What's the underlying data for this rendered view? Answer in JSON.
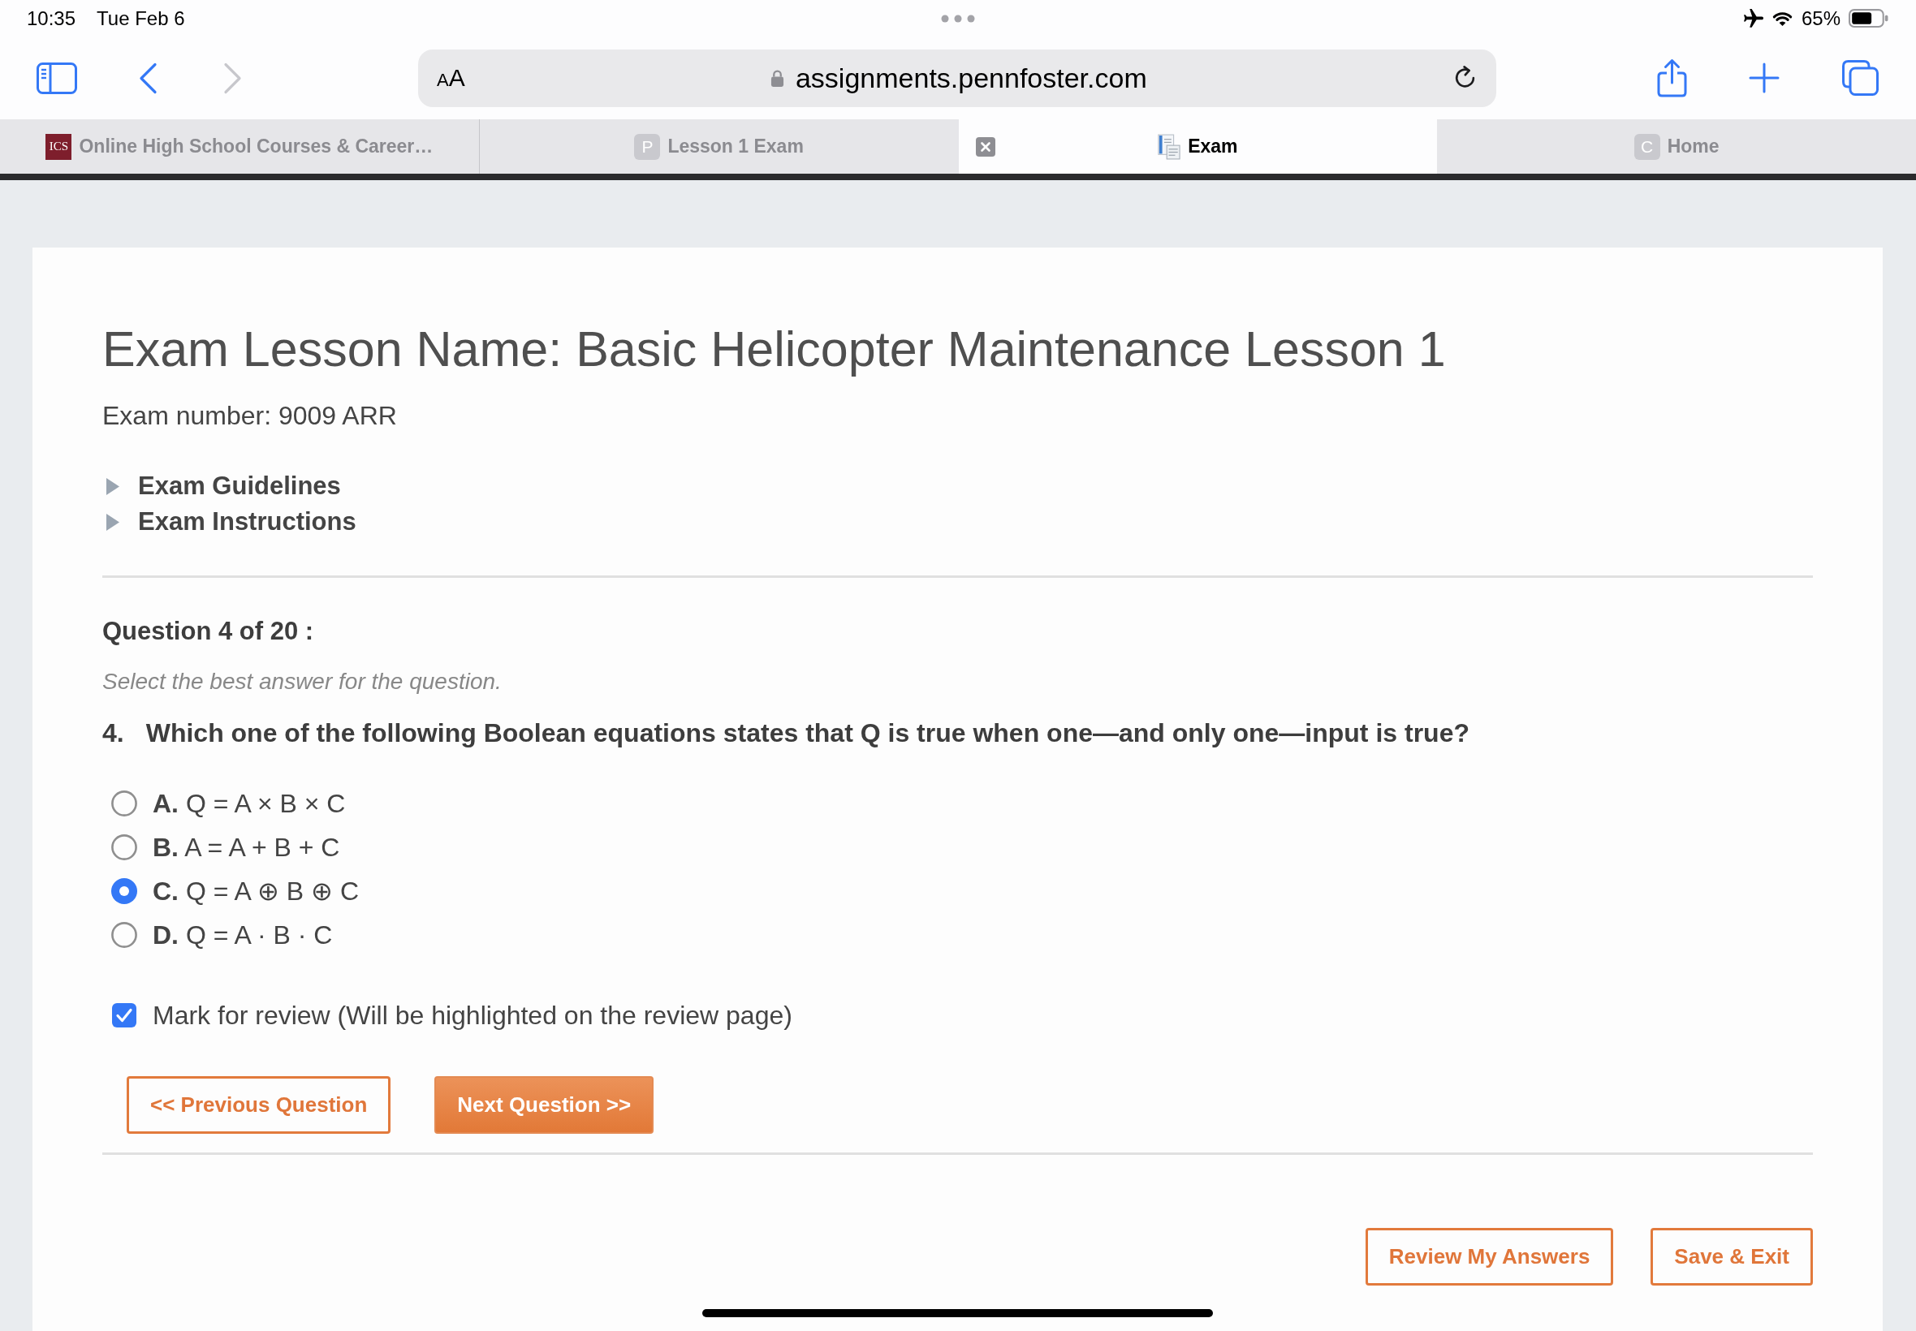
{
  "status_bar": {
    "time": "10:35",
    "date": "Tue Feb 6",
    "battery": "65%"
  },
  "toolbar": {
    "nav_buttons": [
      {
        "kind": "back",
        "disabled": false
      },
      {
        "kind": "forward",
        "disabled": true
      }
    ],
    "text_size_button": {
      "small": "A",
      "large": "A"
    },
    "url": "assignments.pennfoster.com"
  },
  "tabs": [
    {
      "label": "Online High School Courses & Career…",
      "favicon": {
        "kind": "logo",
        "text": "ICS"
      },
      "selected": false
    },
    {
      "label": "Lesson 1 Exam",
      "favicon": {
        "kind": "letter",
        "text": "P"
      },
      "selected": false
    },
    {
      "label": "Exam",
      "favicon": {
        "kind": "document"
      },
      "selected": true
    },
    {
      "label": "Home",
      "favicon": {
        "kind": "letter",
        "text": "C"
      },
      "selected": false
    }
  ],
  "exam": {
    "title": "Exam Lesson Name: Basic Helicopter Maintenance Lesson 1",
    "exam_number": "Exam number: 9009 ARR",
    "sections": [
      {
        "label": "Exam Guidelines",
        "expanded": false
      },
      {
        "label": "Exam Instructions",
        "expanded": false
      }
    ]
  },
  "question": {
    "heading": "Question 4 of 20 :",
    "instruction": "Select the best answer for the question.",
    "number": "4.",
    "text": "Which one of the following Boolean equations states that Q is true when one—and only one—input is true?",
    "options": [
      {
        "letter": "A.",
        "text": "Q = A × B × C",
        "selected": false
      },
      {
        "letter": "B.",
        "text": "A = A + B + C",
        "selected": false
      },
      {
        "letter": "C.",
        "text": "Q = A ⊕ B ⊕ C",
        "selected": true
      },
      {
        "letter": "D.",
        "text": "Q = A · B · C",
        "selected": false
      }
    ],
    "mark_for_review": {
      "label": "Mark for review (Will be highlighted on the review page)",
      "checked": true
    }
  },
  "navigation_buttons": [
    {
      "label": "<< Previous Question",
      "kind": "outline"
    },
    {
      "label": "Next Question >>",
      "kind": "filled"
    }
  ],
  "footer_buttons": [
    {
      "label": "Review My Answers"
    },
    {
      "label": "Save & Exit"
    }
  ]
}
